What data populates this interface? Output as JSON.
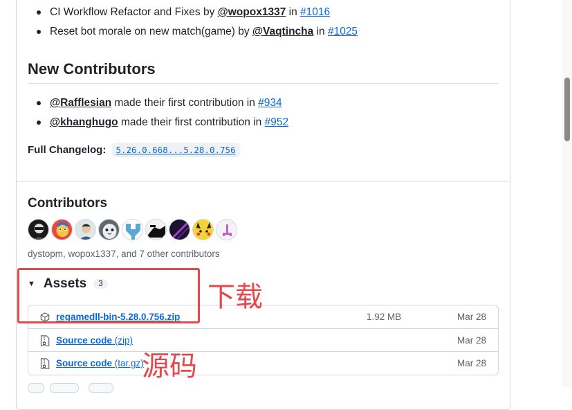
{
  "release_notes": {
    "items": [
      {
        "text": "CI Workflow Refactor and Fixes by ",
        "author": "@wopox1337",
        "in": " in ",
        "pr": "#1016"
      },
      {
        "text": "Reset bot morale on new match(game) by ",
        "author": "@Vaqtincha",
        "in": " in ",
        "pr": "#1025"
      }
    ]
  },
  "new_contributors": {
    "title": "New Contributors",
    "items": [
      {
        "author": "@Rafflesian",
        "text": " made their first contribution in ",
        "pr": "#934"
      },
      {
        "author": "@khanghugo",
        "text": " made their first contribution in ",
        "pr": "#952"
      }
    ]
  },
  "changelog": {
    "label": "Full Changelog:",
    "range": "5.26.0.668...5.28.0.756"
  },
  "contributors": {
    "title": "Contributors",
    "summary": "dystopm, wopox1337, and 7 other contributors",
    "avatars": [
      "avatar-1",
      "avatar-2",
      "avatar-3",
      "avatar-4",
      "avatar-5",
      "avatar-6",
      "avatar-7",
      "avatar-8",
      "avatar-9"
    ]
  },
  "assets": {
    "title": "Assets",
    "count": "3",
    "rows": [
      {
        "icon": "package-icon",
        "name": "regamedll-bin-5.28.0.756.zip",
        "ext": "",
        "size": "1.92 MB",
        "date": "Mar 28"
      },
      {
        "icon": "file-zip-icon",
        "name": "Source code",
        "ext": " (zip)",
        "size": "",
        "date": "Mar 28"
      },
      {
        "icon": "file-zip-icon",
        "name": "Source code",
        "ext": " (tar.gz)",
        "size": "",
        "date": "Mar 28"
      }
    ]
  },
  "annotations": {
    "download_label": "下载",
    "source_label": "源码",
    "color": "#e5484d"
  },
  "colors": {
    "link": "#0969da",
    "text": "#1f2328",
    "muted": "#59636e",
    "border": "#d0d7de"
  }
}
